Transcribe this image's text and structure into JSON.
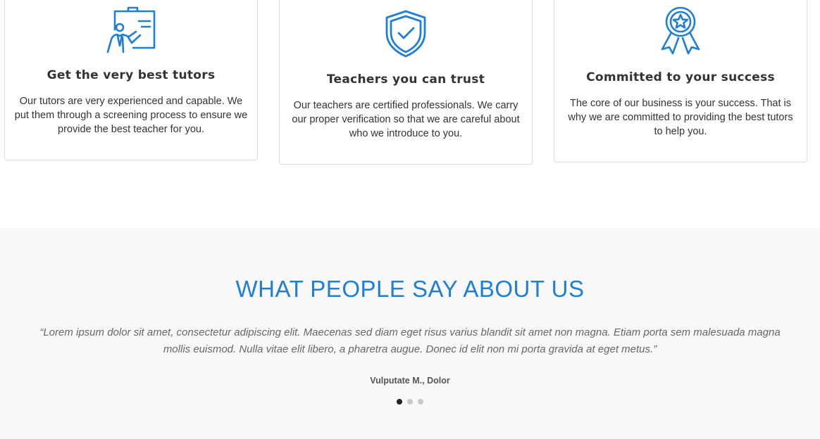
{
  "colors": {
    "accent": "#1f7fd7",
    "section_background": "#f8f8f8",
    "text": "#333333",
    "dot_active": "#222222",
    "dot_inactive": "#c8c8c8"
  },
  "features": [
    {
      "icon": "teacher-presentation-icon",
      "title": "Get the very best tutors",
      "text": "Our tutors are very experienced and capable. We put them through a screening process to ensure we provide the best teacher for you."
    },
    {
      "icon": "shield-check-icon",
      "title": "Teachers you can trust",
      "text": "Our teachers are certified professionals. We carry our proper verification so that we are careful about who we introduce to you."
    },
    {
      "icon": "award-ribbon-icon",
      "title": "Committed to your success",
      "text": "The core of our business is your success. That is why we are committed to providing the best tutors to help you."
    }
  ],
  "testimonials": {
    "heading": "WHAT PEOPLE SAY ABOUT US",
    "quote": "“Lorem ipsum dolor sit amet, consectetur adipiscing elit. Maecenas sed diam eget risus varius blandit sit amet non magna. Etiam porta sem malesuada magna mollis euismod. Nulla vitae elit libero, a pharetra augue. Donec id elit non mi porta gravida at eget metus.”",
    "author": "Vulputate M., Dolor",
    "carousel": {
      "total": 3,
      "active_index": 0
    }
  }
}
